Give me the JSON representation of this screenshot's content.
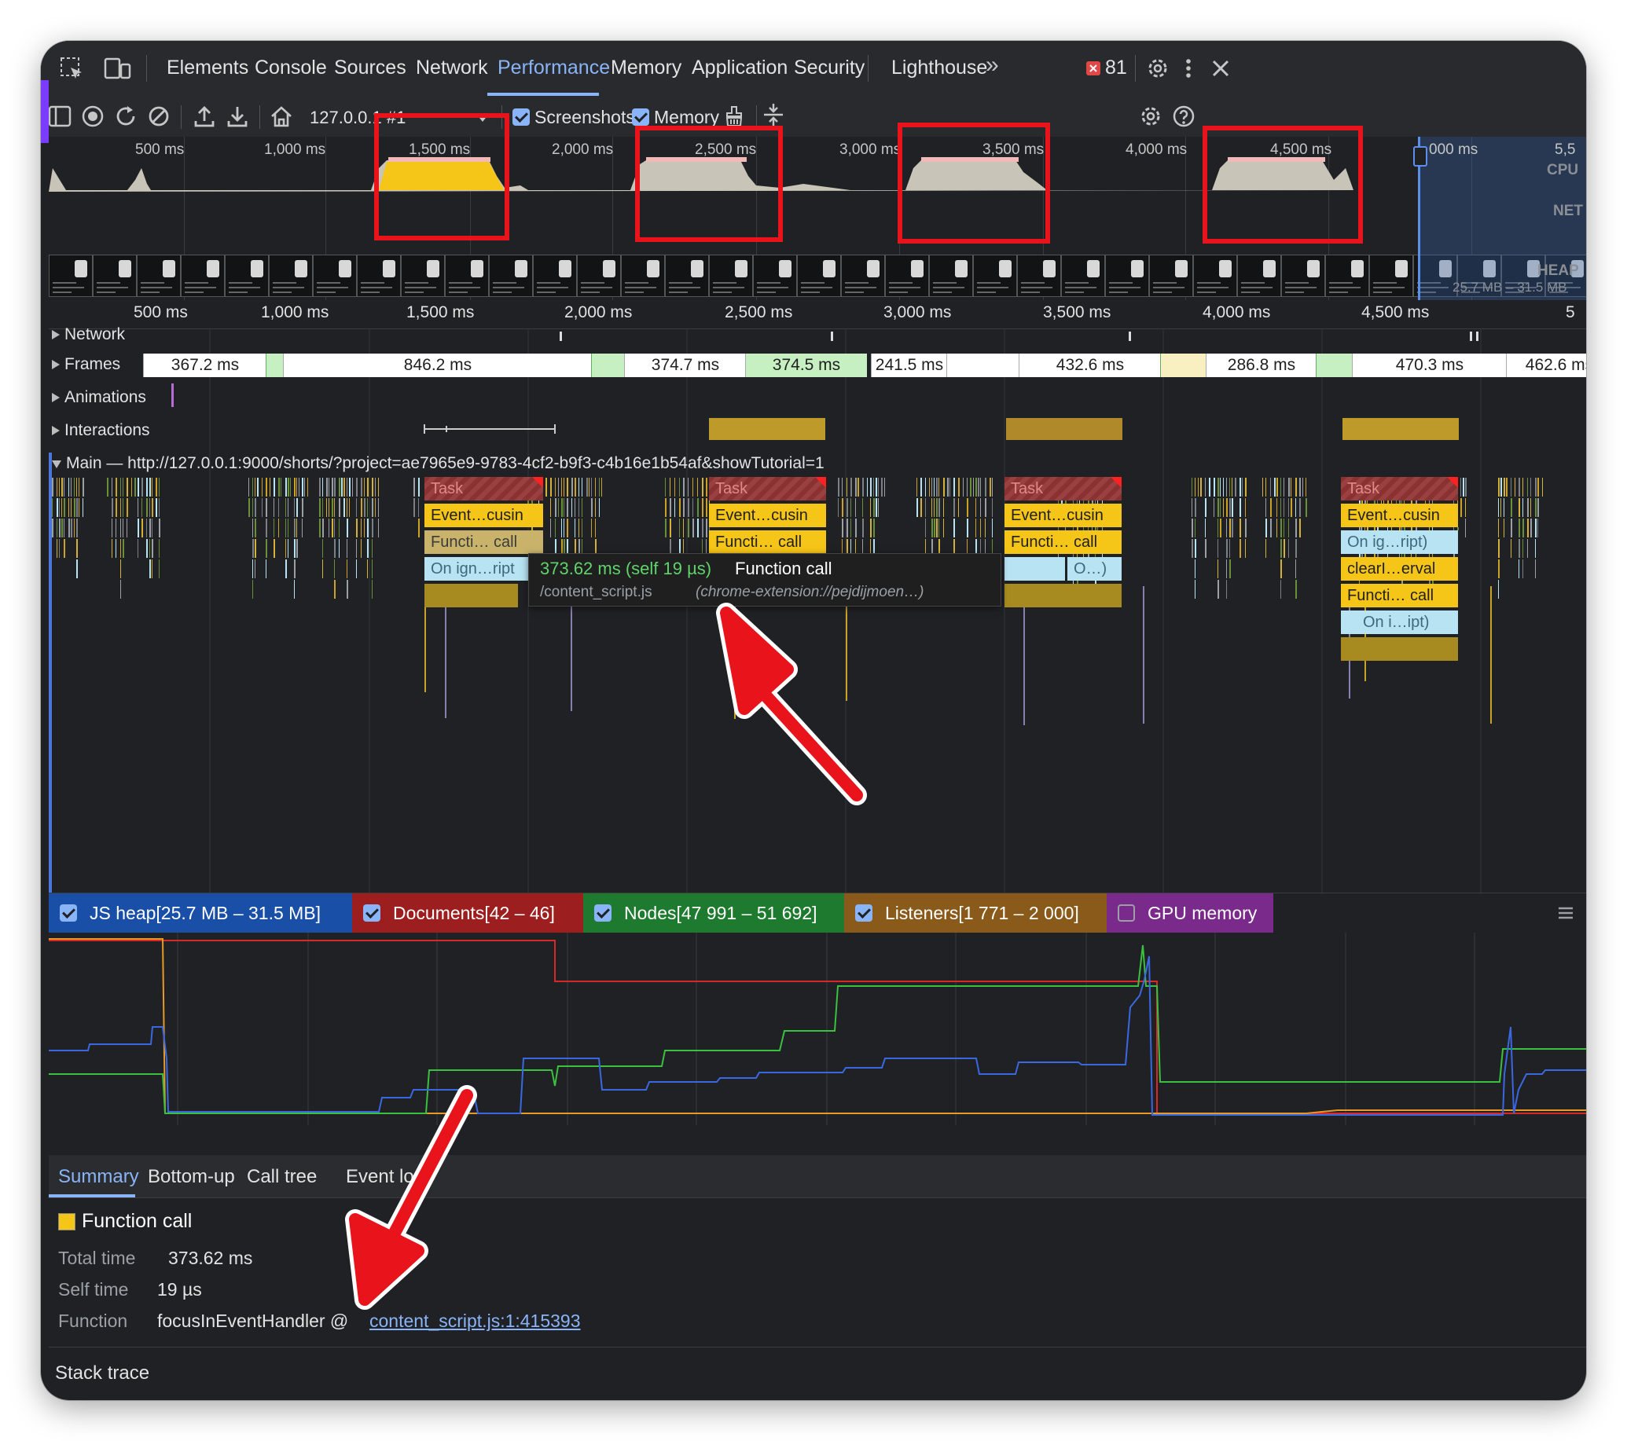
{
  "tabs": [
    "Elements",
    "Console",
    "Sources",
    "Network",
    "Performance",
    "Memory",
    "Application",
    "Security",
    "Lighthouse"
  ],
  "more_tabs_glyph": "»",
  "error_count": "81",
  "toolbar": {
    "session": "127.0.0.1 #1",
    "screenshots_label": "Screenshots",
    "memory_label": "Memory"
  },
  "overview": {
    "ticks": [
      "500 ms",
      "1,000 ms",
      "1,500 ms",
      "2,000 ms",
      "2,500 ms",
      "3,000 ms",
      "3,500 ms",
      "4,000 ms",
      "4,500 ms",
      "5,000 ms",
      "5,5"
    ],
    "labels": {
      "cpu": "CPU",
      "net": "NET",
      "heap": "HEAP"
    },
    "heap_range": "25.7 MB – 31.5 MB",
    "selection_tick": "000 ms"
  },
  "ruler": [
    "500 ms",
    "1,000 ms",
    "1,500 ms",
    "2,000 ms",
    "2,500 ms",
    "3,000 ms",
    "3,500 ms",
    "4,000 ms",
    "4,500 ms",
    "5"
  ],
  "tracks": {
    "network": "Network",
    "frames": "Frames",
    "animations": "Animations",
    "interactions": "Interactions",
    "main": "Main — http://127.0.0.1:9000/shorts/?project=ae7965e9-9783-4cf2-b9f3-c4b16e1b54af&showTutorial=1"
  },
  "frames": [
    "367.2 ms",
    "846.2 ms",
    "374.7 ms",
    "374.5 ms",
    "241.5 ms",
    "432.6 ms",
    "286.8 ms",
    "470.3 ms",
    "462.6 ms"
  ],
  "flame": {
    "task": "Task",
    "event": "Event…cusin",
    "func": "Functi… call",
    "on_ign": "On ign…ript",
    "on_ig2": "On ig…ript)",
    "o": "O…)",
    "clear": "clearI…erval",
    "on_i": "On i…ipt)"
  },
  "tooltip": {
    "time": "373.62 ms (self 19 µs)",
    "name": "Function call",
    "file": "/content_script.js",
    "origin": "(chrome-extension://pejdijmoen…)"
  },
  "memory_legend": [
    {
      "label": "JS heap[25.7 MB – 31.5 MB]",
      "color": "#1a4fa8",
      "checked": true
    },
    {
      "label": "Documents[42 – 46]",
      "color": "#9c1e1e",
      "checked": true
    },
    {
      "label": "Nodes[47 991 – 51 692]",
      "color": "#1e7a2e",
      "checked": true
    },
    {
      "label": "Listeners[1 771 – 2 000]",
      "color": "#8a5a1a",
      "checked": true
    },
    {
      "label": "GPU memory",
      "color": "#7a2a8a",
      "checked": false
    }
  ],
  "bottom_tabs": [
    "Summary",
    "Bottom-up",
    "Call tree",
    "Event log"
  ],
  "summary": {
    "title": "Function call",
    "total_time_label": "Total time",
    "total_time": "373.62 ms",
    "self_time_label": "Self time",
    "self_time": "19 µs",
    "function_label": "Function",
    "function_name": "focusInEventHandler @",
    "function_link": "content_script.js:1:415393",
    "stack_trace": "Stack trace"
  },
  "colors": {
    "accent": "#8ab4f8",
    "panel": "#202124",
    "annotation": "#e8131b"
  }
}
